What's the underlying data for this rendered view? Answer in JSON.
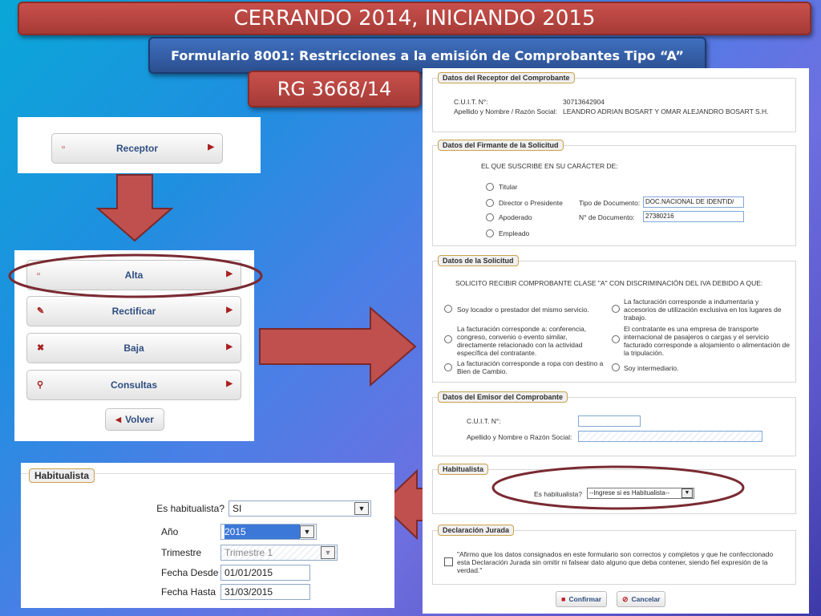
{
  "title": "CERRANDO 2014, INICIANDO 2015",
  "subtitle": "Formulario 8001: Restricciones a la emisión de Comprobantes Tipo “A”",
  "rg": "RG 3668/14",
  "receptor_button": {
    "label": "Receptor"
  },
  "menu": [
    {
      "label": "Alta",
      "icon": "document-icon"
    },
    {
      "label": "Rectificar",
      "icon": "pencil-icon"
    },
    {
      "label": "Baja",
      "icon": "x-icon"
    },
    {
      "label": "Consultas",
      "icon": "magnifier-icon"
    }
  ],
  "back_button": {
    "label": "Volver"
  },
  "habitualista_panel": {
    "legend": "Habitualista",
    "es_habitualista_label": "Es habitualista?",
    "es_habitualista_value": "SI",
    "anio_label": "Año",
    "anio_value": "2015",
    "trimestre_label": "Trimestre",
    "trimestre_value": "Trimestre 1",
    "fecha_desde_label": "Fecha Desde",
    "fecha_desde_value": "01/01/2015",
    "fecha_hasta_label": "Fecha Hasta",
    "fecha_hasta_value": "31/03/2015"
  },
  "form": {
    "receptor": {
      "legend": "Datos del Receptor del Comprobante",
      "cuit_label": "C.U.I.T. N°:",
      "cuit_value": "30713642904",
      "nombre_label": "Apellido y Nombre / Razón Social:",
      "nombre_value": "LEANDRO ADRIAN BOSART Y OMAR ALEJANDRO BOSART S.H."
    },
    "firmante": {
      "legend": "Datos del Firmante de la Solicitud",
      "intro": "EL QUE SUSCRIBE EN SU CARÁCTER DE:",
      "options": [
        "Titular",
        "Director o Presidente",
        "Apoderado",
        "Empleado"
      ],
      "tipo_doc_label": "Tipo de Documento:",
      "tipo_doc_value": "DOC.NACIONAL DE IDENTID/",
      "nro_doc_label": "N° de Documento:",
      "nro_doc_value": "27380216"
    },
    "solicitud": {
      "legend": "Datos de la Solicitud",
      "intro": "SOLICITO RECIBIR COMPROBANTE CLASE \"A\" CON DISCRIMINACIÓN DEL IVA DEBIDO A QUE:",
      "opt1": "Soy locador o prestador del mismo servicio.",
      "opt2": "La facturación corresponde a indumentaria y accesorios de utilización exclusiva en los lugares de trabajo.",
      "opt3": "La facturación corresponde a: conferencia, congreso, convenio o evento similar, directamente relacionado con la actividad específica del contratante.",
      "opt4": "El contratante es una empresa de transporte internacional de pasajeros o cargas y el servicio facturado corresponde a alojamiento o alimentación de la tripulación.",
      "opt5": "La facturación corresponde a ropa con destino a Bien de Cambio.",
      "opt6": "Soy intermediario."
    },
    "emisor": {
      "legend": "Datos del Emisor del Comprobante",
      "cuit_label": "C.U.I.T. N°:",
      "nombre_label": "Apellido y Nombre o Razón Social:"
    },
    "habitualista": {
      "legend": "Habitualista",
      "label": "Es habitualista?",
      "select_value": "--Ingrese si es Habitualista--"
    },
    "declaracion": {
      "legend": "Declaración Jurada",
      "text": "\"Afirmo que los datos consignados en este formulario son correctos y completos y que he confeccionado esta Declaración Jurada sin omitir ni falsear dato alguno que deba contener, siendo fiel expresión de la verdad.\""
    },
    "confirmar_label": "Confirmar",
    "cancelar_label": "Cancelar"
  },
  "colors": {
    "banner_red": "#b2423e",
    "banner_blue": "#33599f",
    "arrow_red": "#c0504d",
    "ellipse": "#7a2a32"
  }
}
